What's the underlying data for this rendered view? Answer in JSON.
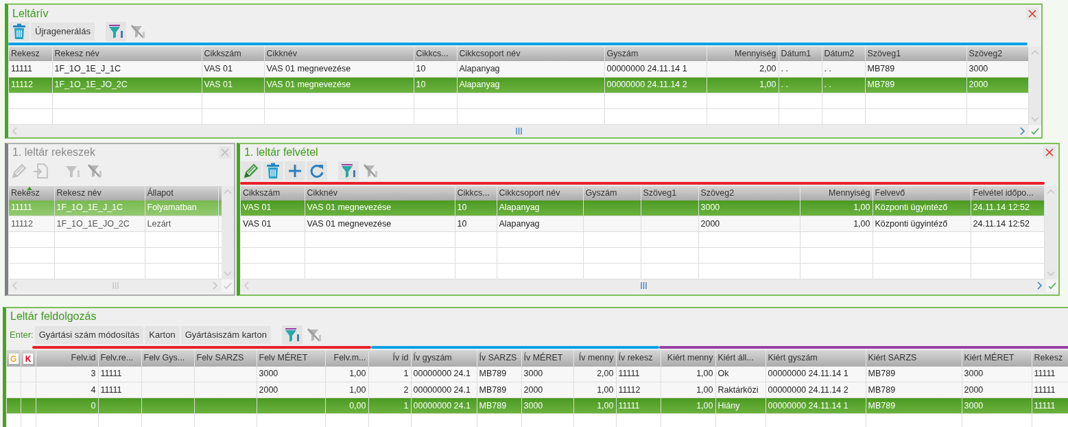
{
  "panels": [
    {
      "title": "Leltárív",
      "active": true,
      "closable": true,
      "toolbar": [
        {
          "kind": "delete",
          "disabled": false
        },
        {
          "kind": "text",
          "label": "Újragenerálás",
          "disabled": false
        },
        {
          "kind": "filter",
          "disabled": false
        },
        {
          "kind": "filter-clear",
          "disabled": true
        }
      ],
      "grid": {
        "columns": [
          "Rekesz",
          "Rekesz név",
          "Cikkszám",
          "Cikknév",
          "Cikkcs...",
          "Cikkcsoport név",
          "Gyszám",
          "Mennyiség",
          "Dátum1",
          "Dátum2",
          "Szöveg1",
          "Szöveg2"
        ],
        "rows": [
          {
            "cells": [
              "11111",
              "1F_1O_1E_J_1C",
              "VAS 01",
              "VAS 01 megnevezése",
              "10",
              "Alapanyag",
              "00000000 24.11.14 1",
              "2,00",
              ". .",
              ". .",
              "MB789",
              "3000"
            ],
            "selected": false
          },
          {
            "cells": [
              "11112",
              "1F_1O_1E_JO_2C",
              "VAS 01",
              "VAS 01 megnevezése",
              "10",
              "Alapanyag",
              "00000000 24.11.14 2",
              "1,00",
              ". .",
              ". .",
              "MB789",
              "2000"
            ],
            "selected": true
          }
        ]
      }
    },
    {
      "title": "1. leltár rekeszek",
      "active": false,
      "closable": true,
      "toolbar": [
        {
          "kind": "edit",
          "disabled": true
        },
        {
          "kind": "import",
          "disabled": true
        },
        {
          "kind": "filter",
          "disabled": true
        },
        {
          "kind": "filter-clear",
          "disabled": true
        }
      ],
      "grid": {
        "columns": [
          "Rekesz",
          "Rekesz név",
          "Állapot"
        ],
        "rows": [
          {
            "cells": [
              "11111",
              "1F_1O_1E_J_1C",
              "Folyamatban"
            ],
            "selected": true
          },
          {
            "cells": [
              "11112",
              "1F_1O_1E_JO_2C",
              "Lezárt"
            ],
            "selected": false
          }
        ]
      }
    },
    {
      "title": "1. leltár felvétel",
      "active": true,
      "closable": true,
      "toolbar": [
        {
          "kind": "edit",
          "disabled": false
        },
        {
          "kind": "delete",
          "disabled": false
        },
        {
          "kind": "add",
          "disabled": false
        },
        {
          "kind": "refresh",
          "disabled": false
        },
        {
          "kind": "filter",
          "disabled": false
        },
        {
          "kind": "filter-clear",
          "disabled": true
        }
      ],
      "grid": {
        "columns": [
          "Cikkszám",
          "Cikknév",
          "Cikkcs...",
          "Cikkcsoport név",
          "Gyszám",
          "Szöveg1",
          "Szöveg2",
          "Mennyiség",
          "Felvevő",
          "Felvétel időpo..."
        ],
        "rows": [
          {
            "cells": [
              "VAS 01",
              "VAS 01 megnevezése",
              "10",
              "Alapanyag",
              "",
              "",
              "3000",
              "1,00",
              "Központi ügyintéző",
              "24.11.14 12:52"
            ],
            "selected": true
          },
          {
            "cells": [
              "VAS 01",
              "VAS 01 megnevezése",
              "10",
              "Alapanyag",
              "",
              "",
              "2000",
              "1,00",
              "Központi ügyintéző",
              "24.11.14 12:52"
            ],
            "selected": false
          }
        ]
      }
    },
    {
      "title": "Leltár feldolgozás",
      "active": true,
      "closable": false,
      "toolbar": [
        {
          "kind": "label",
          "label": "Enter:",
          "disabled": false
        },
        {
          "kind": "text",
          "label": "Gyártási szám módosítás",
          "disabled": false
        },
        {
          "kind": "text",
          "label": "Karton",
          "disabled": false
        },
        {
          "kind": "text",
          "label": "Gyártásiszám karton",
          "disabled": false
        },
        {
          "kind": "filter",
          "disabled": false
        },
        {
          "kind": "filter-clear",
          "disabled": true
        }
      ],
      "grid": {
        "flags": [
          {
            "label": "G",
            "color": "#f5a623"
          },
          {
            "label": "K",
            "color": "#e3001b"
          }
        ],
        "columns": [
          "Felv.id",
          "Felv.re...",
          "Felv Gys...",
          "Felv SARZS",
          "Felv MÉRET",
          "Felv.m...",
          "Ív id",
          "Ív gyszám",
          "Ív SARZS",
          "Ív MÉRET",
          "Ív menny",
          "Ív rekesz",
          "Kiért menny",
          "Kiért áll...",
          "Kiért gyszám",
          "Kiért SARZS",
          "Kiért MÉRET",
          "Rekesz"
        ],
        "rows": [
          {
            "cells": [
              "3",
              "11111",
              "",
              "",
              "3000",
              "1,00",
              "1",
              "00000000 24.1",
              "MB789",
              "3000",
              "2,00",
              "11111",
              "1,00",
              "Ok",
              "00000000 24.11.14 1",
              "MB789",
              "3000",
              "11111"
            ],
            "selected": false
          },
          {
            "cells": [
              "4",
              "11111",
              "",
              "",
              "2000",
              "1,00",
              "2",
              "00000000 24.1",
              "MB789",
              "2000",
              "1,00",
              "11112",
              "1,00",
              "Raktárközi",
              "00000000 24.11.14 2",
              "MB789",
              "2000",
              "11111"
            ],
            "selected": false
          },
          {
            "cells": [
              "0",
              "",
              "",
              "",
              "",
              "0,00",
              "1",
              "00000000 24.1",
              "MB789",
              "3000",
              "1,00",
              "11111",
              "1,00",
              "Hiány",
              "00000000 24.11.14 1",
              "MB789",
              "3000",
              "11111"
            ],
            "selected": true
          }
        ]
      }
    }
  ]
}
